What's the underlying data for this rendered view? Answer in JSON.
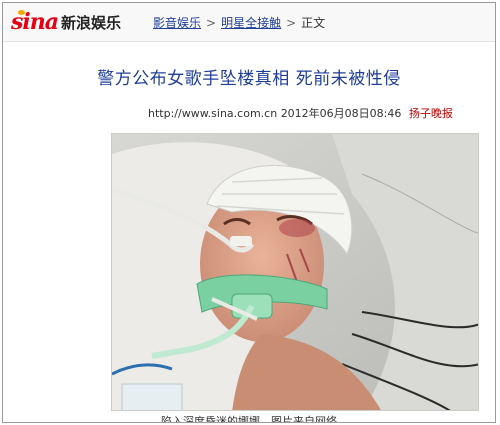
{
  "header": {
    "logo_wordmark": "sina",
    "logo_text": "新浪娱乐",
    "breadcrumb": [
      "影音娱乐",
      "明星全接触",
      "正文"
    ],
    "separator": ">"
  },
  "article": {
    "title": "警方公布女歌手坠楼真相 死前未被性侵",
    "url": "http://www.sina.com.cn",
    "datetime": "2012年06月08日08:46",
    "source": "扬子晚报"
  },
  "photo": {
    "caption": "陷入深度昏迷的娜娜。图片来自网络"
  }
}
